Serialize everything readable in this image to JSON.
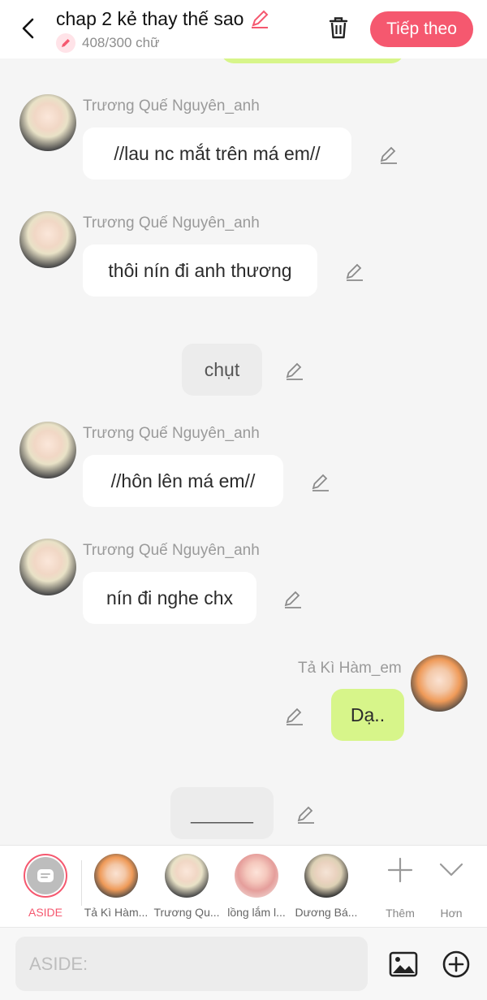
{
  "header": {
    "title": "chap 2 kẻ thay thế sao",
    "word_count": "408/300 chữ",
    "next_label": "Tiếp theo",
    "accent": "#f5586f"
  },
  "messages": [
    {
      "sender": "Trương Quế Nguyên_anh",
      "text": "//lau nc mắt trên má em//"
    },
    {
      "sender": "Trương Quế Nguyên_anh",
      "text": "thôi nín đi anh thương"
    },
    {
      "aside": "chụt"
    },
    {
      "sender": "Trương Quế Nguyên_anh",
      "text": "//hôn lên má em//"
    },
    {
      "sender": "Trương Quế Nguyên_anh",
      "text": "nín đi nghe chx"
    },
    {
      "sender": "Tả Kì Hàm_em",
      "text": "Dạ.."
    },
    {
      "aside": "______"
    }
  ],
  "characters": [
    {
      "name": "ASIDE"
    },
    {
      "name": "Tả Kì Hàm..."
    },
    {
      "name": "Trương Qu..."
    },
    {
      "name": "lồng lắm l..."
    },
    {
      "name": "Dương Bá..."
    }
  ],
  "tools": {
    "more_label": "Thêm",
    "expand_label": "Hơn"
  },
  "input": {
    "placeholder": "ASIDE:"
  }
}
